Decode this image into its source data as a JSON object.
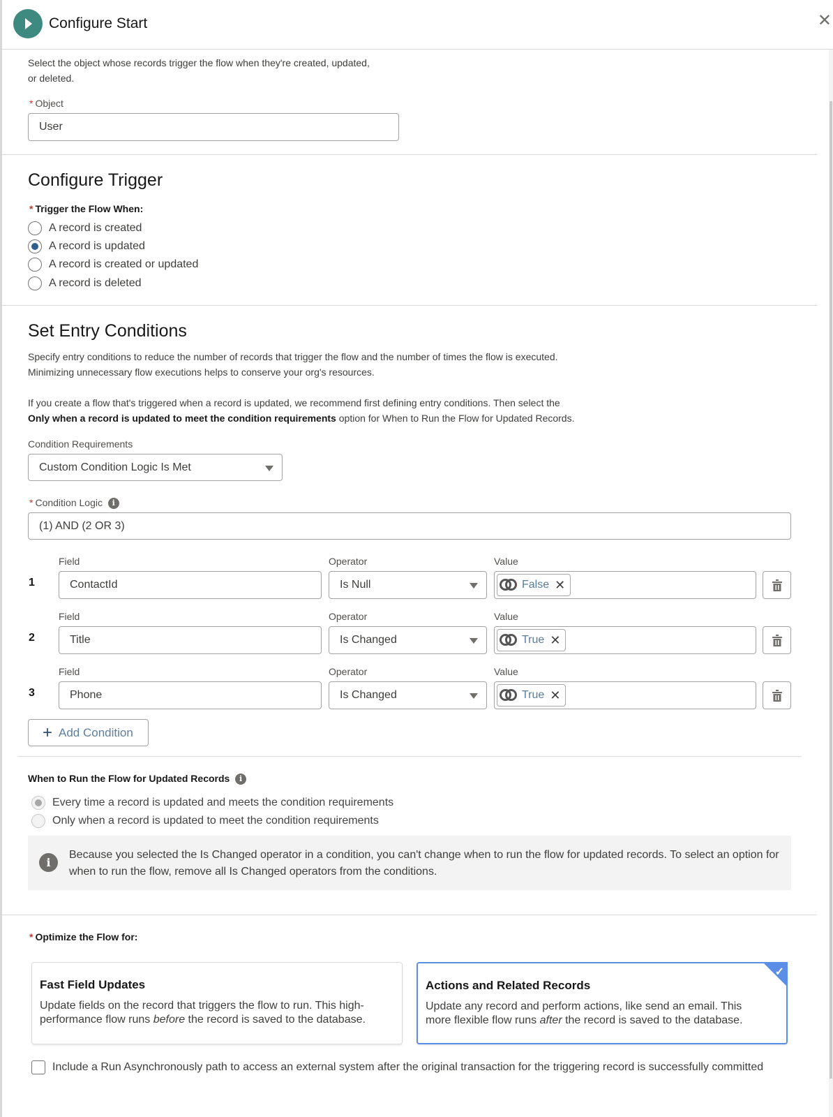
{
  "header": {
    "title": "Configure Start",
    "close_icon": "close-icon"
  },
  "object_section": {
    "description_line1": "Select the object whose records trigger the flow when they're created, updated,",
    "description_line2": "or deleted.",
    "object_label": "Object",
    "required_marker": "*",
    "object_value": "User"
  },
  "trigger_section": {
    "heading": "Configure Trigger",
    "label": "Trigger the Flow When:",
    "options": [
      {
        "label": "A record is created",
        "checked": false
      },
      {
        "label": "A record is updated",
        "checked": true
      },
      {
        "label": "A record is created or updated",
        "checked": false
      },
      {
        "label": "A record is deleted",
        "checked": false
      }
    ]
  },
  "entry_conditions": {
    "heading": "Set Entry Conditions",
    "desc_line1": "Specify entry conditions to reduce the number of records that trigger the flow and the number of times the flow is executed.",
    "desc_line2": "Minimizing unnecessary flow executions helps to conserve your org's resources.",
    "rec_line1": "If you create a flow that's triggered when a record is updated, we recommend first defining entry conditions. Then select the",
    "rec_bold": "Only when a record is updated to meet the condition requirements",
    "rec_rest": " option for When to Run the Flow for Updated Records.",
    "requirements_label": "Condition Requirements",
    "requirements_value": "Custom Condition Logic Is Met",
    "logic_label": "Condition Logic",
    "logic_value": "(1) AND (2 OR 3)",
    "field_label": "Field",
    "operator_label": "Operator",
    "value_label": "Value",
    "conditions": [
      {
        "num": "1",
        "field": "ContactId",
        "operator": "Is Null",
        "value": "False"
      },
      {
        "num": "2",
        "field": "Title",
        "operator": "Is Changed",
        "value": "True"
      },
      {
        "num": "3",
        "field": "Phone",
        "operator": "Is Changed",
        "value": "True"
      }
    ],
    "add_condition_label": "Add Condition"
  },
  "when_to_run": {
    "label": "When to Run the Flow for Updated Records",
    "options": [
      {
        "label": "Every time a record is updated and meets the condition requirements",
        "checked": true,
        "disabled": true
      },
      {
        "label": "Only when a record is updated to meet the condition requirements",
        "checked": false,
        "disabled": true
      }
    ],
    "notice_text": "Because you selected the Is Changed operator in a condition, you can't change when to run the flow for updated records. To select an option for when to run the flow, remove all Is Changed operators from the conditions."
  },
  "optimize": {
    "label": "Optimize the Flow for:",
    "cards": [
      {
        "title": "Fast Field Updates",
        "desc_pre": "Update fields on the record that triggers the flow to run. This high-performance flow runs ",
        "desc_em": "before",
        "desc_post": " the record is saved to the database.",
        "selected": false
      },
      {
        "title": "Actions and Related Records",
        "desc_pre": "Update any record and perform actions, like send an email. This more flexible flow runs ",
        "desc_em": "after",
        "desc_post": " the record is saved to the database.",
        "selected": true
      }
    ],
    "async_checkbox_label": "Include a Run Asynchronously path to access an external system after the original transaction for the triggering record is successfully committed",
    "async_checked": false
  },
  "colors": {
    "accent": "#5b8ee6",
    "start_icon": "#3f8a80",
    "required": "#c23934"
  }
}
